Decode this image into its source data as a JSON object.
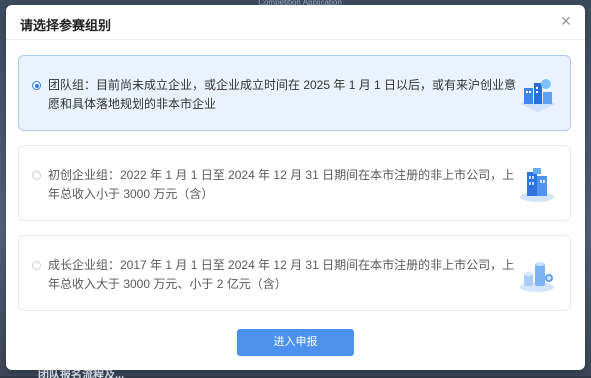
{
  "background": {
    "top_text": "Competition Application",
    "bottom_text": "团队报名流程及..."
  },
  "dialog": {
    "title": "请选择参赛组别",
    "close_icon": "close-icon"
  },
  "options": [
    {
      "selected": true,
      "text": "团队组：目前尚未成立企业，或企业成立时间在 2025 年 1 月 1 日以后，或有来沪创业意愿和具体落地规划的非本市企业",
      "icon": "team-illustration-icon"
    },
    {
      "selected": false,
      "text": "初创企业组：2022 年 1 月 1 日至 2024 年 12 月 31 日期间在本市注册的非上市公司，上年总收入小于 3000 万元（含）",
      "icon": "startup-building-icon"
    },
    {
      "selected": false,
      "text": "成长企业组：2017 年 1 月 1 日至 2024 年 12 月 31 日期间在本市注册的非上市公司，上年总收入大于 3000 万元、小于 2 亿元（含）",
      "icon": "growth-coins-icon"
    }
  ],
  "submit_label": "进入申报",
  "colors": {
    "accent": "#4c91ec",
    "selected_bg": "#eaf3fd",
    "selected_border": "#a9cdf3"
  }
}
